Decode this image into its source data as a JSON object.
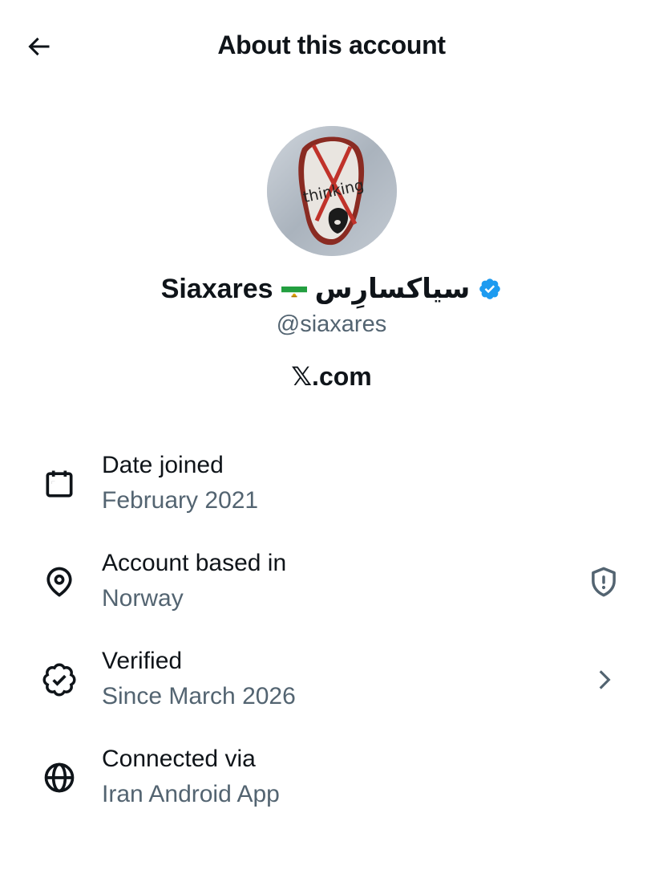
{
  "header": {
    "title": "About this account",
    "back_icon": "arrow-left-icon"
  },
  "profile": {
    "display_name": "Siaxares",
    "flag_icon": "iran-lion-and-sun-flag-icon",
    "display_name_persian": "سیاکسارِس",
    "verified_badge_icon": "verified-badge-icon",
    "handle": "@siaxares",
    "avatar_text": "thinking",
    "domain_prefix": "𝕏",
    "domain_suffix": ".com"
  },
  "details": [
    {
      "icon": "calendar-icon",
      "label": "Date joined",
      "value": "February 2021"
    },
    {
      "icon": "location-pin-icon",
      "label": "Account based in",
      "value": "Norway",
      "trailing_icon": "shield-alert-icon"
    },
    {
      "icon": "verified-outline-icon",
      "label": "Verified",
      "value": "Since March 2026",
      "trailing_icon": "chevron-right-icon"
    },
    {
      "icon": "globe-icon",
      "label": "Connected via",
      "value": "Iran Android App"
    }
  ],
  "colors": {
    "text_primary": "#0f1419",
    "text_secondary": "#536471",
    "verified_blue": "#1d9bf0",
    "background": "#ffffff"
  }
}
